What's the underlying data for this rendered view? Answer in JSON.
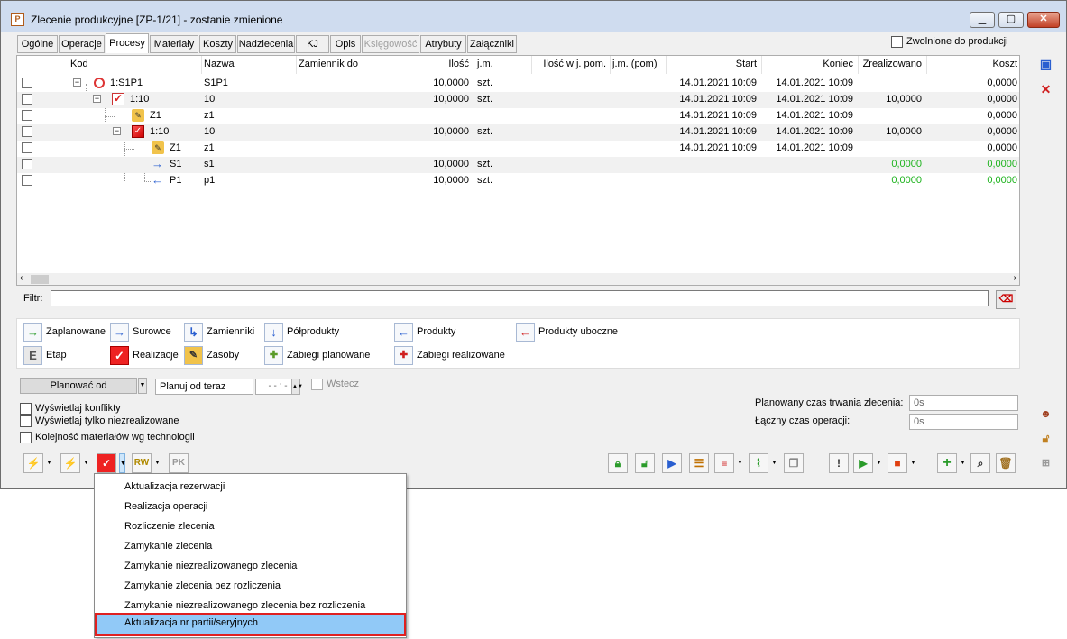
{
  "window": {
    "title": "Zlecenie produkcyjne  [ZP-1/21] - zostanie zmienione",
    "app_icon_glyph": "P",
    "min_glyph": "▁",
    "max_glyph": "▢",
    "close_glyph": "✕"
  },
  "tabs": [
    {
      "label": "Ogólne"
    },
    {
      "label": "Operacje"
    },
    {
      "label": "Procesy",
      "active": true
    },
    {
      "label": "Materiały"
    },
    {
      "label": "Koszty"
    },
    {
      "label": "Nadzlecenia"
    },
    {
      "label": "KJ"
    },
    {
      "label": "Opis"
    },
    {
      "label": "Księgowość",
      "disabled": true
    },
    {
      "label": "Atrybuty"
    },
    {
      "label": "Załączniki"
    }
  ],
  "zwolnione_label": "Zwolnione do produkcji",
  "grid": {
    "headers": {
      "kod": "Kod",
      "nazwa": "Nazwa",
      "zamiennik": "Zamiennik do",
      "ilosc": "Ilość",
      "jm": "j.m.",
      "ilosc_pom": "Ilość w j. pom.",
      "jm_pom": "j.m. (pom)",
      "start": "Start",
      "koniec": "Koniec",
      "zrealizowano": "Zrealizowano",
      "koszt": "Koszt"
    },
    "rows": [
      {
        "icon": "cycle-icon",
        "kod": "1:S1P1",
        "nazwa": "S1P1",
        "ilosc": "10,0000",
        "jm": "szt.",
        "start": "14.01.2021 10:09",
        "koniec": "14.01.2021 10:09",
        "zrealizowano": "",
        "koszt": "0,0000"
      },
      {
        "icon": "realization-check-icon",
        "kod": "1:10",
        "nazwa": "10",
        "ilosc": "10,0000",
        "jm": "szt.",
        "start": "14.01.2021 10:09",
        "koniec": "14.01.2021 10:09",
        "zrealizowano": "10,0000",
        "koszt": "0,0000"
      },
      {
        "icon": "resource-icon",
        "kod": "Z1",
        "nazwa": "z1",
        "ilosc": "",
        "jm": "",
        "start": "14.01.2021 10:09",
        "koniec": "14.01.2021 10:09",
        "zrealizowano": "",
        "koszt": "0,0000"
      },
      {
        "icon": "realization-icon",
        "kod": "1:10",
        "nazwa": "10",
        "ilosc": "10,0000",
        "jm": "szt.",
        "start": "14.01.2021 10:09",
        "koniec": "14.01.2021 10:09",
        "zrealizowano": "10,0000",
        "koszt": "0,0000"
      },
      {
        "icon": "resource-icon",
        "kod": "Z1",
        "nazwa": "z1",
        "ilosc": "",
        "jm": "",
        "start": "14.01.2021 10:09",
        "koniec": "14.01.2021 10:09",
        "zrealizowano": "",
        "koszt": "0,0000"
      },
      {
        "icon": "raw-material-arrow-icon",
        "kod": "S1",
        "nazwa": "s1",
        "ilosc": "10,0000",
        "jm": "szt.",
        "start": "",
        "koniec": "",
        "zrealizowano": "0,0000",
        "koszt": "0,0000"
      },
      {
        "icon": "product-arrow-icon",
        "kod": "P1",
        "nazwa": "p1",
        "ilosc": "10,0000",
        "jm": "szt.",
        "start": "",
        "koniec": "",
        "zrealizowano": "0,0000",
        "koszt": "0,0000"
      }
    ]
  },
  "filter_label": "Filtr:",
  "filter_value": "",
  "legend": {
    "zaplanowane": "Zaplanowane",
    "surowce": "Surowce",
    "zamienniki": "Zamienniki",
    "polprodukty": "Półprodukty",
    "produkty": "Produkty",
    "produkty_uboczne": "Produkty uboczne",
    "etap": "Etap",
    "realizacje": "Realizacje",
    "zasoby": "Zasoby",
    "zabiegi_planowane": "Zabiegi planowane",
    "zabiegi_realizowane": "Zabiegi realizowane",
    "etap_glyph": "E"
  },
  "planning": {
    "planowac_od": "Planować od",
    "planuj_value": "Planuj od teraz",
    "time_value": "- - : -",
    "wstecz": "Wstecz"
  },
  "options": {
    "konflikty": "Wyświetlaj konflikty",
    "niezrealizowane": "Wyświetlaj tylko niezrealizowane",
    "kolejnosc": "Kolejność materiałów wg technologii"
  },
  "durations": {
    "planowany_label": "Planowany czas trwania zlecenia:",
    "planowany_value": "0s",
    "laczny_label": "Łączny czas operacji:",
    "laczny_value": "0s"
  },
  "toolbar": {
    "rw_label": "RW",
    "pk_label": "PK"
  },
  "context_menu": [
    {
      "label": "Aktualizacja rezerwacji"
    },
    {
      "label": "Realizacja operacji"
    },
    {
      "label": "Rozliczenie zlecenia"
    },
    {
      "label": "Zamykanie zlecenia"
    },
    {
      "label": "Zamykanie niezrealizowanego zlecenia"
    },
    {
      "label": "Zamykanie zlecenia bez rozliczenia"
    },
    {
      "label": "Zamykanie niezrealizowanego zlecenia bez rozliczenia"
    },
    {
      "label": "Aktualizacja nr partii/seryjnych",
      "highlighted": true
    }
  ],
  "colors": {
    "title_bar": "#cfdcef",
    "highlight": "#91c9f7",
    "highlight_border": "#e02020",
    "green_value": "#1db31d"
  }
}
